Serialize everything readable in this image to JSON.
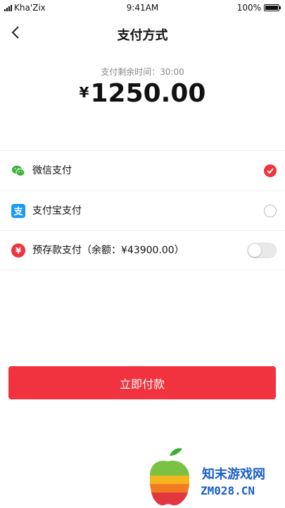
{
  "status_bar": {
    "carrier": "Kha'Zix",
    "time": "9:41AM",
    "battery": "100%"
  },
  "nav": {
    "title": "支付方式"
  },
  "payment": {
    "countdown": "支付剩余时间：30:00",
    "currency": "¥",
    "amount": "1250.00"
  },
  "methods": [
    {
      "label": "微信支付",
      "icon": "wechat-icon",
      "state": "checked",
      "color": "#3cb034"
    },
    {
      "label": "支付宝支付",
      "icon": "alipay-icon",
      "state": "unchecked",
      "color": "#1b9bf0"
    },
    {
      "label": "预存款支付（余额：¥43900.00）",
      "icon": "wallet-icon",
      "state": "toggle-off",
      "color": "#f0333f"
    }
  ],
  "button": {
    "label": "立即付款"
  },
  "watermark": {
    "line1": "知末游戏网",
    "line2": "ZM028.CN"
  },
  "colors": {
    "accent": "#f0333f",
    "muted": "#888888"
  }
}
